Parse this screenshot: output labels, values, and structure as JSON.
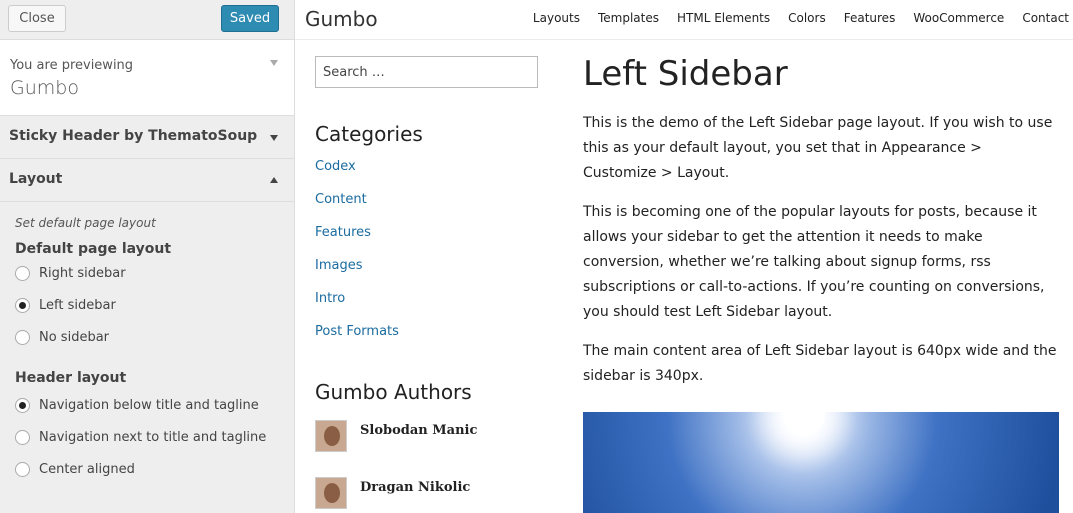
{
  "customizer": {
    "close_label": "Close",
    "saved_label": "Saved",
    "preview_label": "You are previewing",
    "theme_name": "Gumbo",
    "sections": [
      {
        "title": "Sticky Header by ThematoSoup",
        "expanded": false
      },
      {
        "title": "Layout",
        "expanded": true
      }
    ],
    "layout": {
      "description": "Set default page layout",
      "default_layout_title": "Default page layout",
      "default_layout_options": [
        "Right sidebar",
        "Left sidebar",
        "No sidebar"
      ],
      "default_layout_selected": "Left sidebar",
      "header_layout_title": "Header layout",
      "header_layout_options": [
        "Navigation below title and tagline",
        "Navigation next to title and tagline",
        "Center aligned"
      ],
      "header_layout_selected": "Navigation below title and tagline"
    },
    "accent_color": "#2e8bb1"
  },
  "site": {
    "title": "Gumbo",
    "nav": [
      "Layouts",
      "Templates",
      "HTML Elements",
      "Colors",
      "Features",
      "WooCommerce",
      "Contact"
    ],
    "search_placeholder": "Search …",
    "categories_title": "Categories",
    "categories": [
      "Codex",
      "Content",
      "Features",
      "Images",
      "Intro",
      "Post Formats"
    ],
    "authors_title": "Gumbo Authors",
    "authors": [
      "Slobodan Manic",
      "Dragan Nikolic"
    ],
    "link_color": "#1a6ba0",
    "page_title": "Left Sidebar",
    "paragraphs": [
      "This is the demo of the Left Sidebar page layout. If you wish to use this as your default layout, you set that in Appearance > Customize > Layout.",
      "This is becoming one of the popular layouts for posts, because it allows your sidebar to get the attention it needs to make conversion, whether we’re talking about signup forms, rss subscriptions or call-to-actions. If you’re counting on conversions, you should test Left Sidebar layout.",
      "The main content area of Left Sidebar layout is 640px wide and the sidebar is 340px."
    ]
  }
}
